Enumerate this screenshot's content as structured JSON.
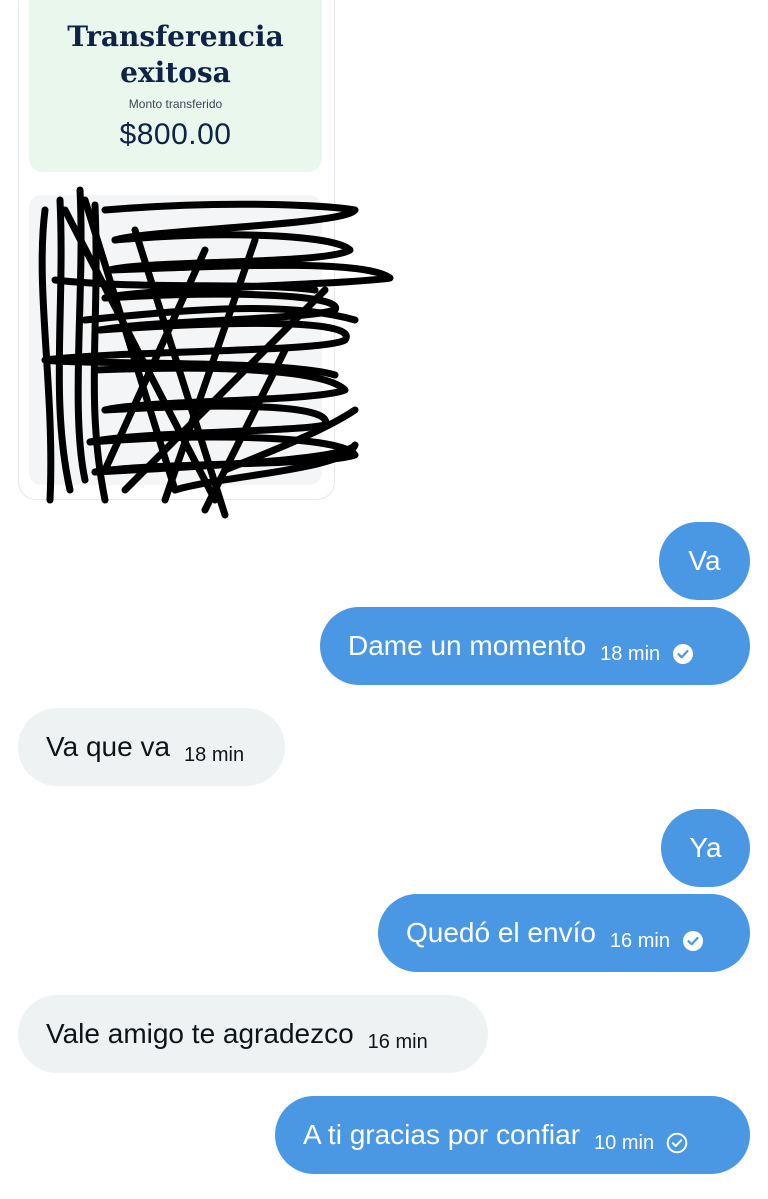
{
  "receipt": {
    "title": "Transferencia exitosa",
    "amount_label": "Monto transferido",
    "amount": "$800.00",
    "colors": {
      "card_top": "#e9f7ec",
      "title": "#0f2346",
      "badge": "#2f6d3a"
    }
  },
  "colors": {
    "sent_bubble": "#4a97e4",
    "received_bubble": "#eff2f3",
    "sent_text": "#ffffff",
    "received_text": "#0f1419"
  },
  "messages": [
    {
      "side": "sent",
      "text": "Va",
      "time": "",
      "read_icon": ""
    },
    {
      "side": "sent",
      "text": "Dame un momento",
      "time": "18 min",
      "read_icon": "check-circle-filled-icon"
    },
    {
      "side": "received",
      "text": "Va que va",
      "time": "18 min"
    },
    {
      "side": "sent",
      "text": "Ya",
      "time": "",
      "read_icon": ""
    },
    {
      "side": "sent",
      "text": "Quedó el envío",
      "time": "16 min",
      "read_icon": "check-circle-filled-icon"
    },
    {
      "side": "received",
      "text": "Vale amigo te agradezco",
      "time": "16 min"
    },
    {
      "side": "sent",
      "text": "A ti gracias por confiar",
      "time": "10 min",
      "read_icon": "check-circle-outline-icon"
    }
  ]
}
